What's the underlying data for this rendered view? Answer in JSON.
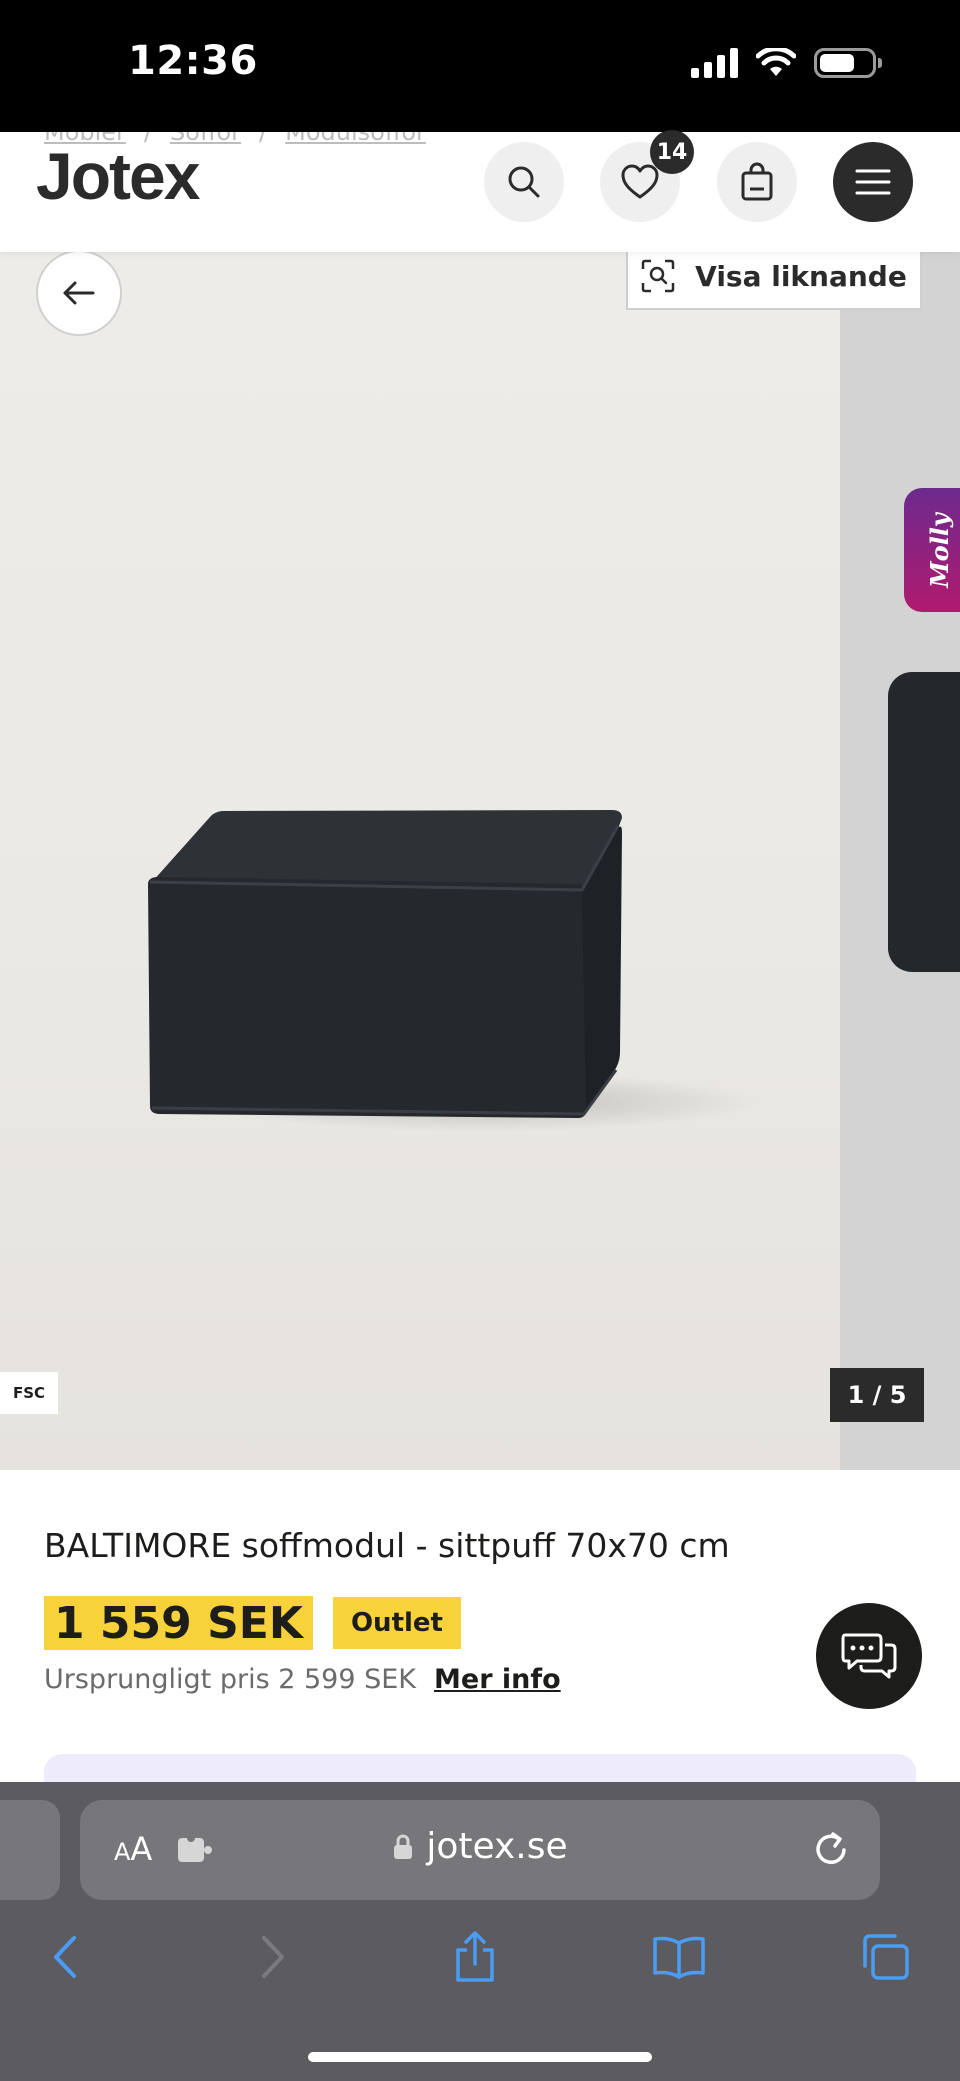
{
  "status_bar": {
    "time": "12:36"
  },
  "header": {
    "breadcrumb": [
      "Möbler",
      "Soffor",
      "Modulsoffor"
    ],
    "logo": "Jotex",
    "wishlist_count": "14"
  },
  "gallery": {
    "similar_label": "Visa liknande",
    "assistant_label": "Molly",
    "cert_label": "FSC",
    "counter": "1 / 5"
  },
  "product": {
    "title": "BALTIMORE soffmodul - sittpuff 70x70 cm",
    "price": "1 559 SEK",
    "tag": "Outlet",
    "original_price": "Ursprungligt pris 2 599 SEK",
    "more_info": "Mer info"
  },
  "browser": {
    "text_size_label": "AA",
    "url": "jotex.se"
  },
  "colors": {
    "price_highlight": "#f8d23a",
    "dark": "#1d1d1b",
    "assistant_gradient_start": "#6d2a8e",
    "assistant_gradient_end": "#b01a6e",
    "browser_accent": "#4a9cf5"
  }
}
